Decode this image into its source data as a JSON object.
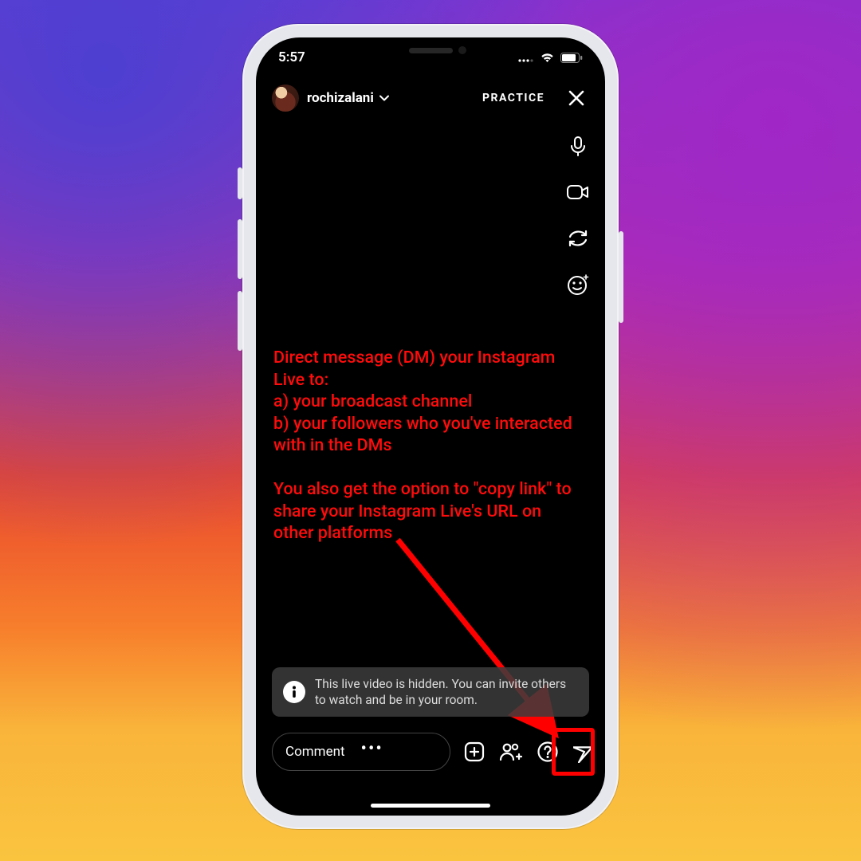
{
  "status_bar": {
    "time": "5:57",
    "signal_icon": "signal-icon",
    "wifi_icon": "wifi-icon",
    "battery_icon": "battery-icon"
  },
  "live_header": {
    "username": "rochizalani",
    "mode_label": "PRACTICE"
  },
  "right_tools": {
    "mic": "microphone-icon",
    "camera": "video-camera-icon",
    "flip": "camera-flip-icon",
    "effects": "face-effects-icon"
  },
  "annotation_text": "Direct message (DM) your Instagram Live to:\na) your broadcast channel\nb) your followers who you've interacted with in the DMs\n\nYou also get the option to \"copy link\" to share your Instagram Live's URL on other platforms",
  "info_banner": {
    "text": "This live video is hidden. You can invite others to watch and be in your room."
  },
  "bottom_bar": {
    "comment_placeholder": "Comment",
    "icons": {
      "add_media": "add-media-icon",
      "invite": "invite-people-icon",
      "question": "question-icon",
      "share": "share-send-icon"
    }
  },
  "colors": {
    "annotation_red": "#ff0b0b",
    "highlight_red": "#ff0000"
  }
}
